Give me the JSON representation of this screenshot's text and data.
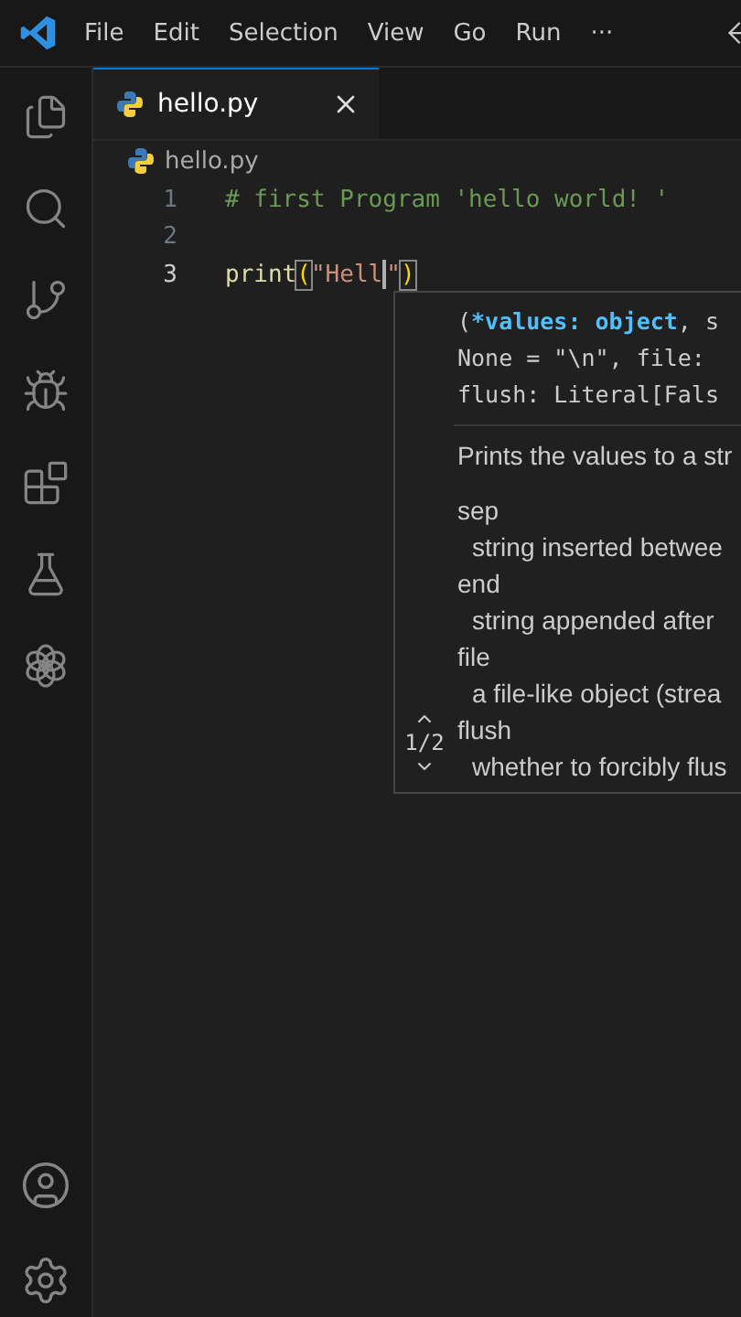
{
  "menu": {
    "items": [
      "File",
      "Edit",
      "Selection",
      "View",
      "Go",
      "Run",
      "···"
    ]
  },
  "tabs": [
    {
      "label": "hello.py",
      "selected": true
    }
  ],
  "breadcrumb": "hello.py",
  "editor": {
    "lines": [
      {
        "number": "1",
        "current": false,
        "tokens": [
          {
            "kind": "comment",
            "text": "# first Program 'hello world! '"
          }
        ]
      },
      {
        "number": "2",
        "current": false
      },
      {
        "number": "3",
        "current": true,
        "tokens": [
          {
            "kind": "function",
            "text": "print"
          },
          {
            "kind": "bracket",
            "text": "("
          },
          {
            "kind": "string",
            "text": "\"Hell"
          },
          {
            "kind": "cursor"
          },
          {
            "kind": "string",
            "text": "\""
          },
          {
            "kind": "bracket",
            "text": ")"
          }
        ]
      }
    ]
  },
  "signature_help": {
    "page": "1/2",
    "signature": [
      [
        {
          "kind": "plain",
          "text": "("
        },
        {
          "kind": "active",
          "text": "*values: object"
        },
        {
          "kind": "plain",
          "text": ", s"
        }
      ],
      [
        {
          "kind": "plain",
          "text": "None = \"\\n\", file:"
        }
      ],
      [
        {
          "kind": "plain",
          "text": "flush: Literal[Fals"
        }
      ]
    ],
    "summary": "Prints the values to a str",
    "params": [
      {
        "name": "sep",
        "description": "string inserted betwee"
      },
      {
        "name": "end",
        "description": "string appended after"
      },
      {
        "name": "file",
        "description": "a file-like object (strea"
      },
      {
        "name": "flush",
        "description": "whether to forcibly flus"
      }
    ]
  }
}
